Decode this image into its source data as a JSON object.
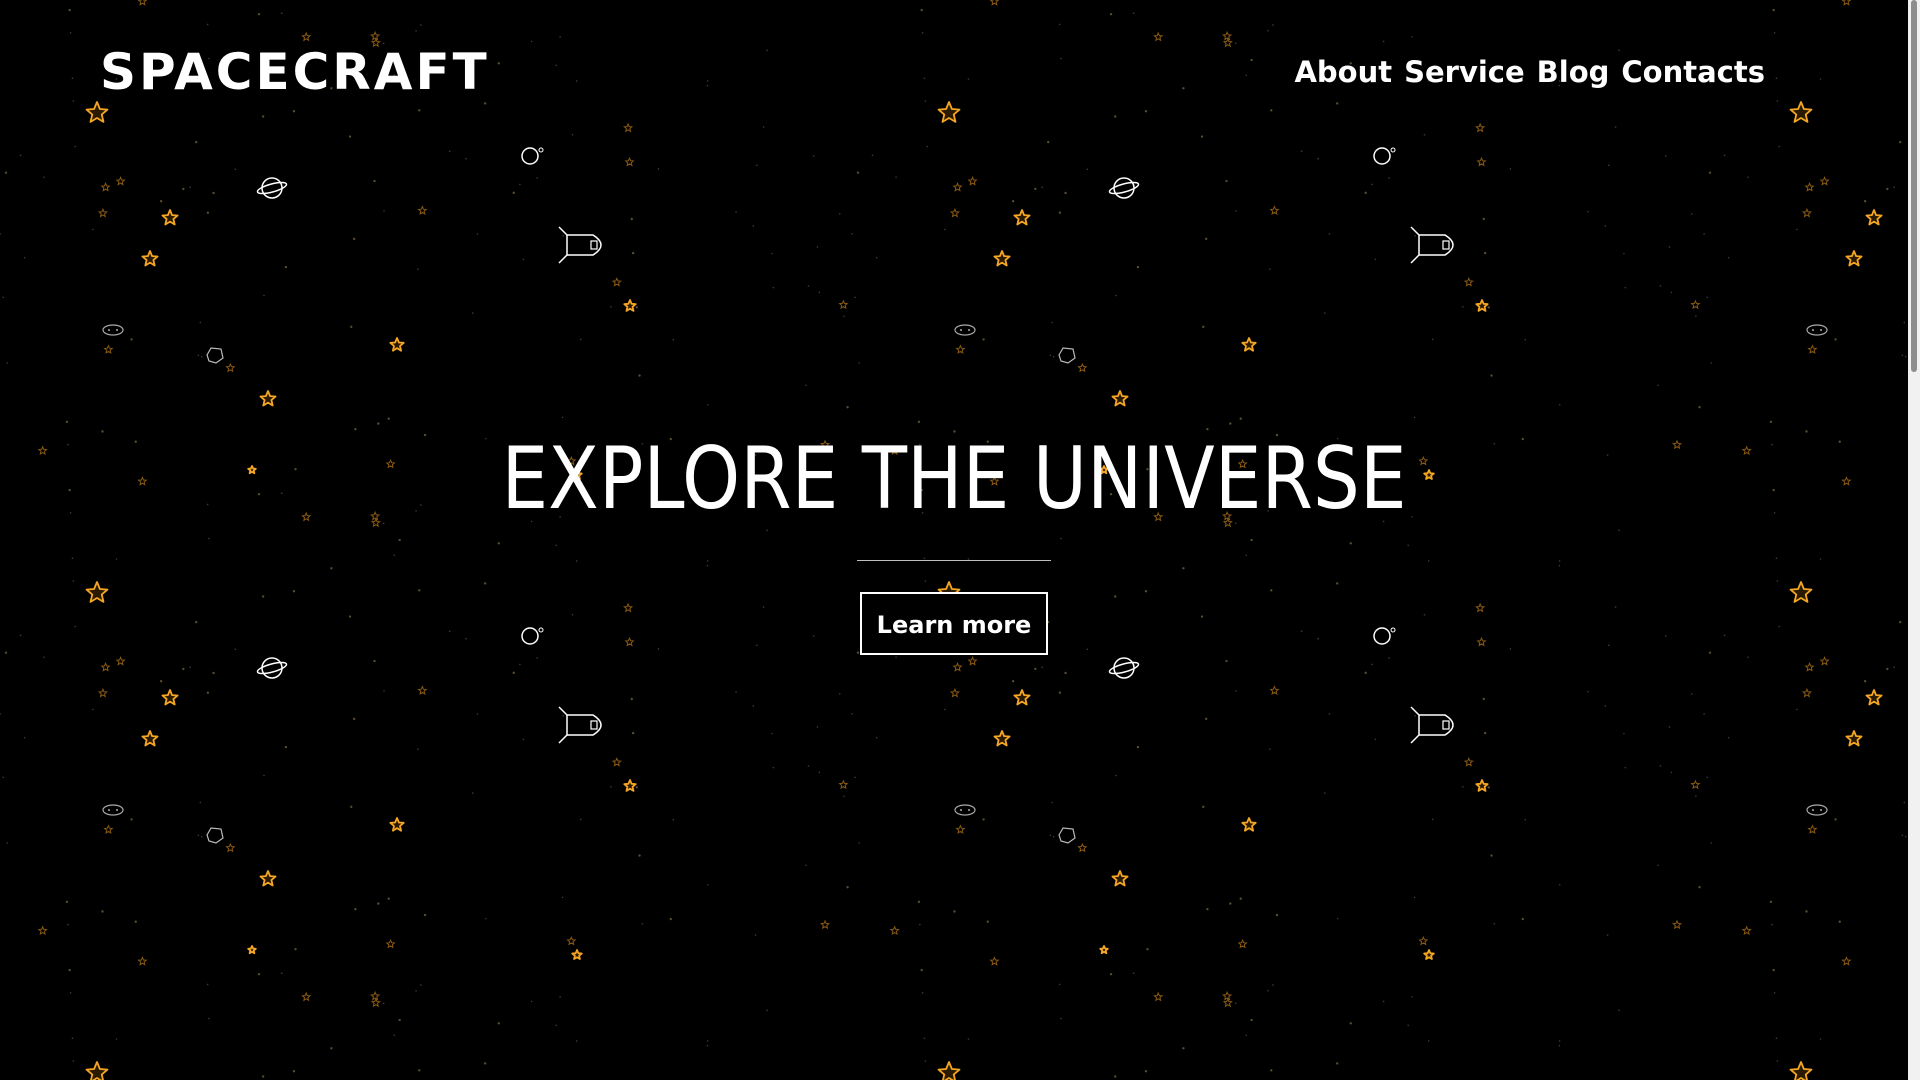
{
  "brand": {
    "logo_text": "SPACECRAFT"
  },
  "nav": {
    "items": [
      {
        "label": "About"
      },
      {
        "label": "Service"
      },
      {
        "label": "Blog"
      },
      {
        "label": "Contacts"
      }
    ]
  },
  "hero": {
    "title": "EXPLORE THE UNIVERSE",
    "button_label": "Learn more"
  },
  "background": {
    "pattern_icons": [
      "star-icon",
      "small-star-icon",
      "planet-icon",
      "moon-icon",
      "rocket-icon",
      "ufo-icon",
      "asteroid-icon"
    ]
  },
  "colors": {
    "background": "#000000",
    "text": "#ffffff",
    "star_accent": "#f5a623",
    "star_fill": "#2a1a00",
    "outline_icon": "#ffffff",
    "divider": "#bfbfbf"
  }
}
